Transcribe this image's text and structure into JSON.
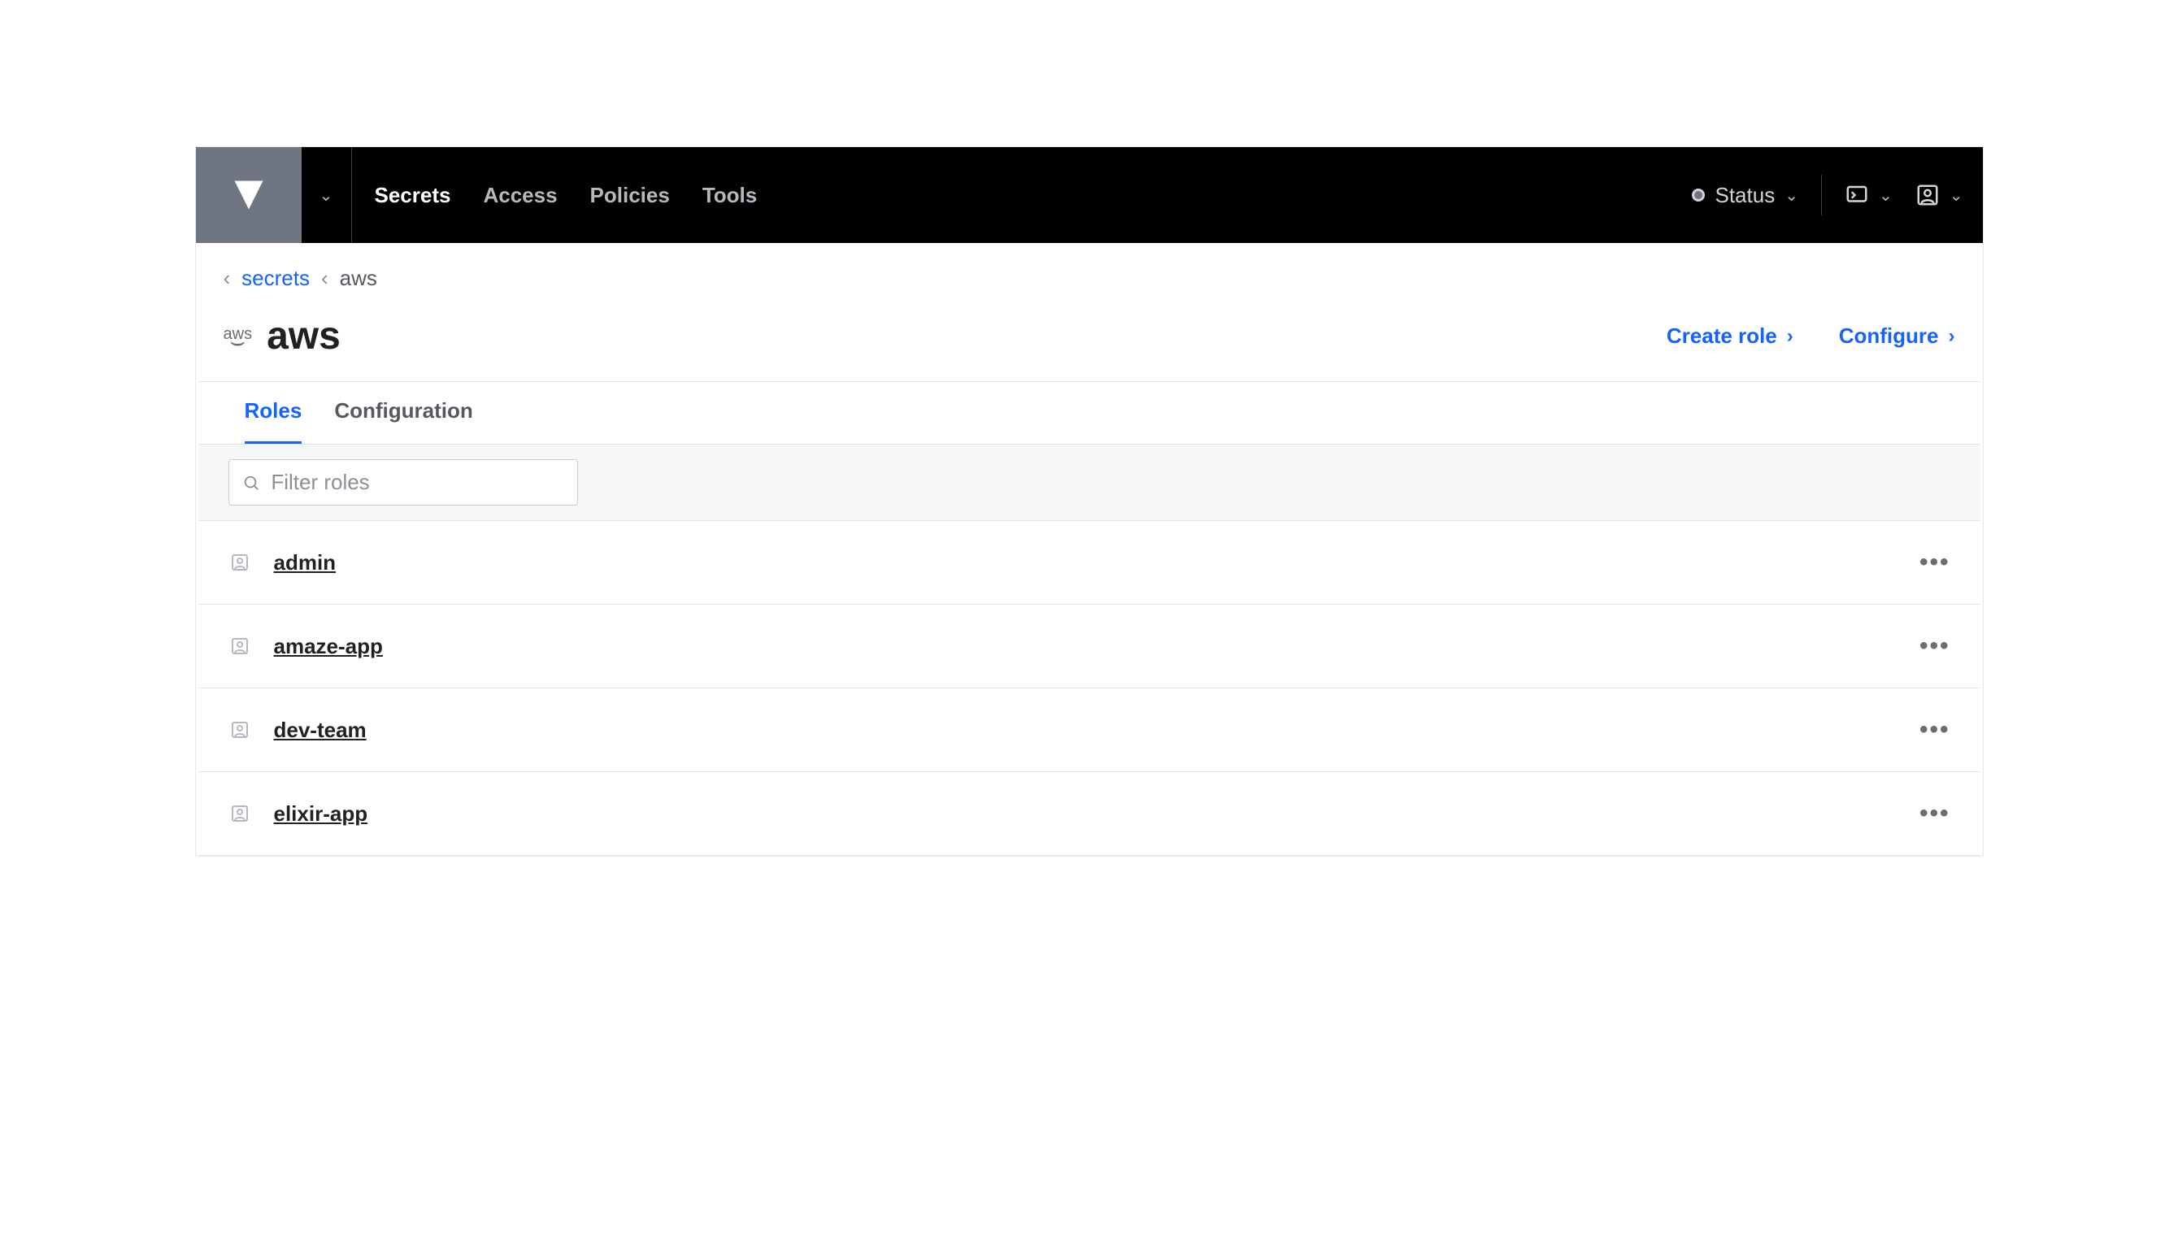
{
  "topnav": {
    "items": [
      "Secrets",
      "Access",
      "Policies",
      "Tools"
    ],
    "active_index": 0,
    "status_label": "Status"
  },
  "breadcrumb": {
    "parent": "secrets",
    "current": "aws"
  },
  "page": {
    "icon_label": "aws",
    "title": "aws",
    "actions": {
      "create": "Create role",
      "configure": "Configure"
    }
  },
  "tabs": {
    "items": [
      "Roles",
      "Configuration"
    ],
    "active_index": 0
  },
  "filter": {
    "placeholder": "Filter roles",
    "value": ""
  },
  "roles": [
    {
      "name": "admin"
    },
    {
      "name": "amaze-app"
    },
    {
      "name": "dev-team"
    },
    {
      "name": "elixir-app"
    }
  ]
}
